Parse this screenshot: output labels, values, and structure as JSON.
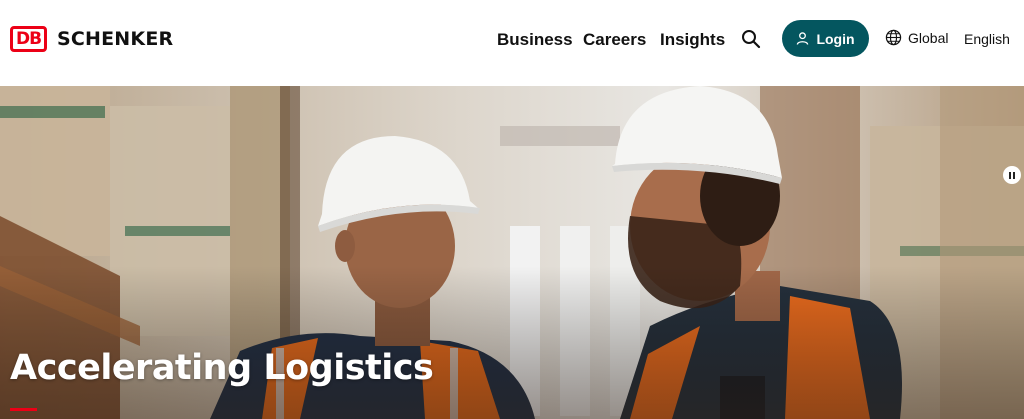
{
  "brand": {
    "mark": "DB",
    "name": "SCHENKER",
    "accent_color": "#ec0016"
  },
  "nav": {
    "items": [
      "Business",
      "Careers",
      "Insights"
    ]
  },
  "search": {
    "icon": "search-icon"
  },
  "login": {
    "label": "Login",
    "icon": "user-icon",
    "color": "#04565f"
  },
  "region": {
    "label": "Global",
    "icon": "globe-icon"
  },
  "language": {
    "label": "English"
  },
  "hero": {
    "title": "Accelerating Logistics",
    "pause_icon": "pause-icon"
  }
}
